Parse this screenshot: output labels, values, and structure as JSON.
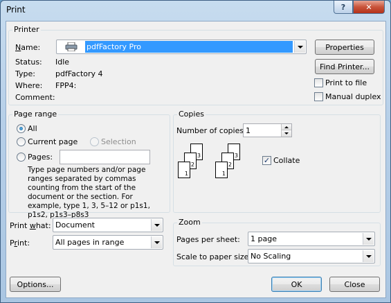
{
  "window": {
    "title": "Print",
    "help": "?",
    "close": "✕"
  },
  "printer": {
    "group_label": "Printer",
    "name_label": "Name:",
    "name_value": "pdfFactory Pro",
    "status_label": "Status:",
    "status_value": "Idle",
    "type_label": "Type:",
    "type_value": "pdfFactory 4",
    "where_label": "Where:",
    "where_value": "FPP4:",
    "comment_label": "Comment:",
    "properties_button": "Properties",
    "find_printer_button": "Find Printer...",
    "print_to_file": "Print to file",
    "manual_duplex": "Manual duplex"
  },
  "page_range": {
    "group_label": "Page range",
    "all": "All",
    "current_page": "Current page",
    "selection": "Selection",
    "pages": "Pages:",
    "help_text": "Type page numbers and/or page ranges separated by commas counting from the start of the document or the section. For example, type 1, 3, 5–12 or p1s1, p1s2, p1s3–p8s3"
  },
  "copies": {
    "group_label": "Copies",
    "number_label": "Number of copies:",
    "number_value": "1",
    "collate": "Collate",
    "collate_checked": "✓"
  },
  "print_what": {
    "label": "Print what:",
    "value": "Document"
  },
  "print": {
    "label": "Print:",
    "value": "All pages in range"
  },
  "zoom": {
    "group_label": "Zoom",
    "pages_per_sheet_label": "Pages per sheet:",
    "pages_per_sheet_value": "1 page",
    "scale_label": "Scale to paper size:",
    "scale_value": "No Scaling"
  },
  "buttons": {
    "options": "Options...",
    "ok": "OK",
    "close": "Close"
  },
  "colors": {
    "selection": "#3399ff",
    "title_close": "#c9553b"
  }
}
